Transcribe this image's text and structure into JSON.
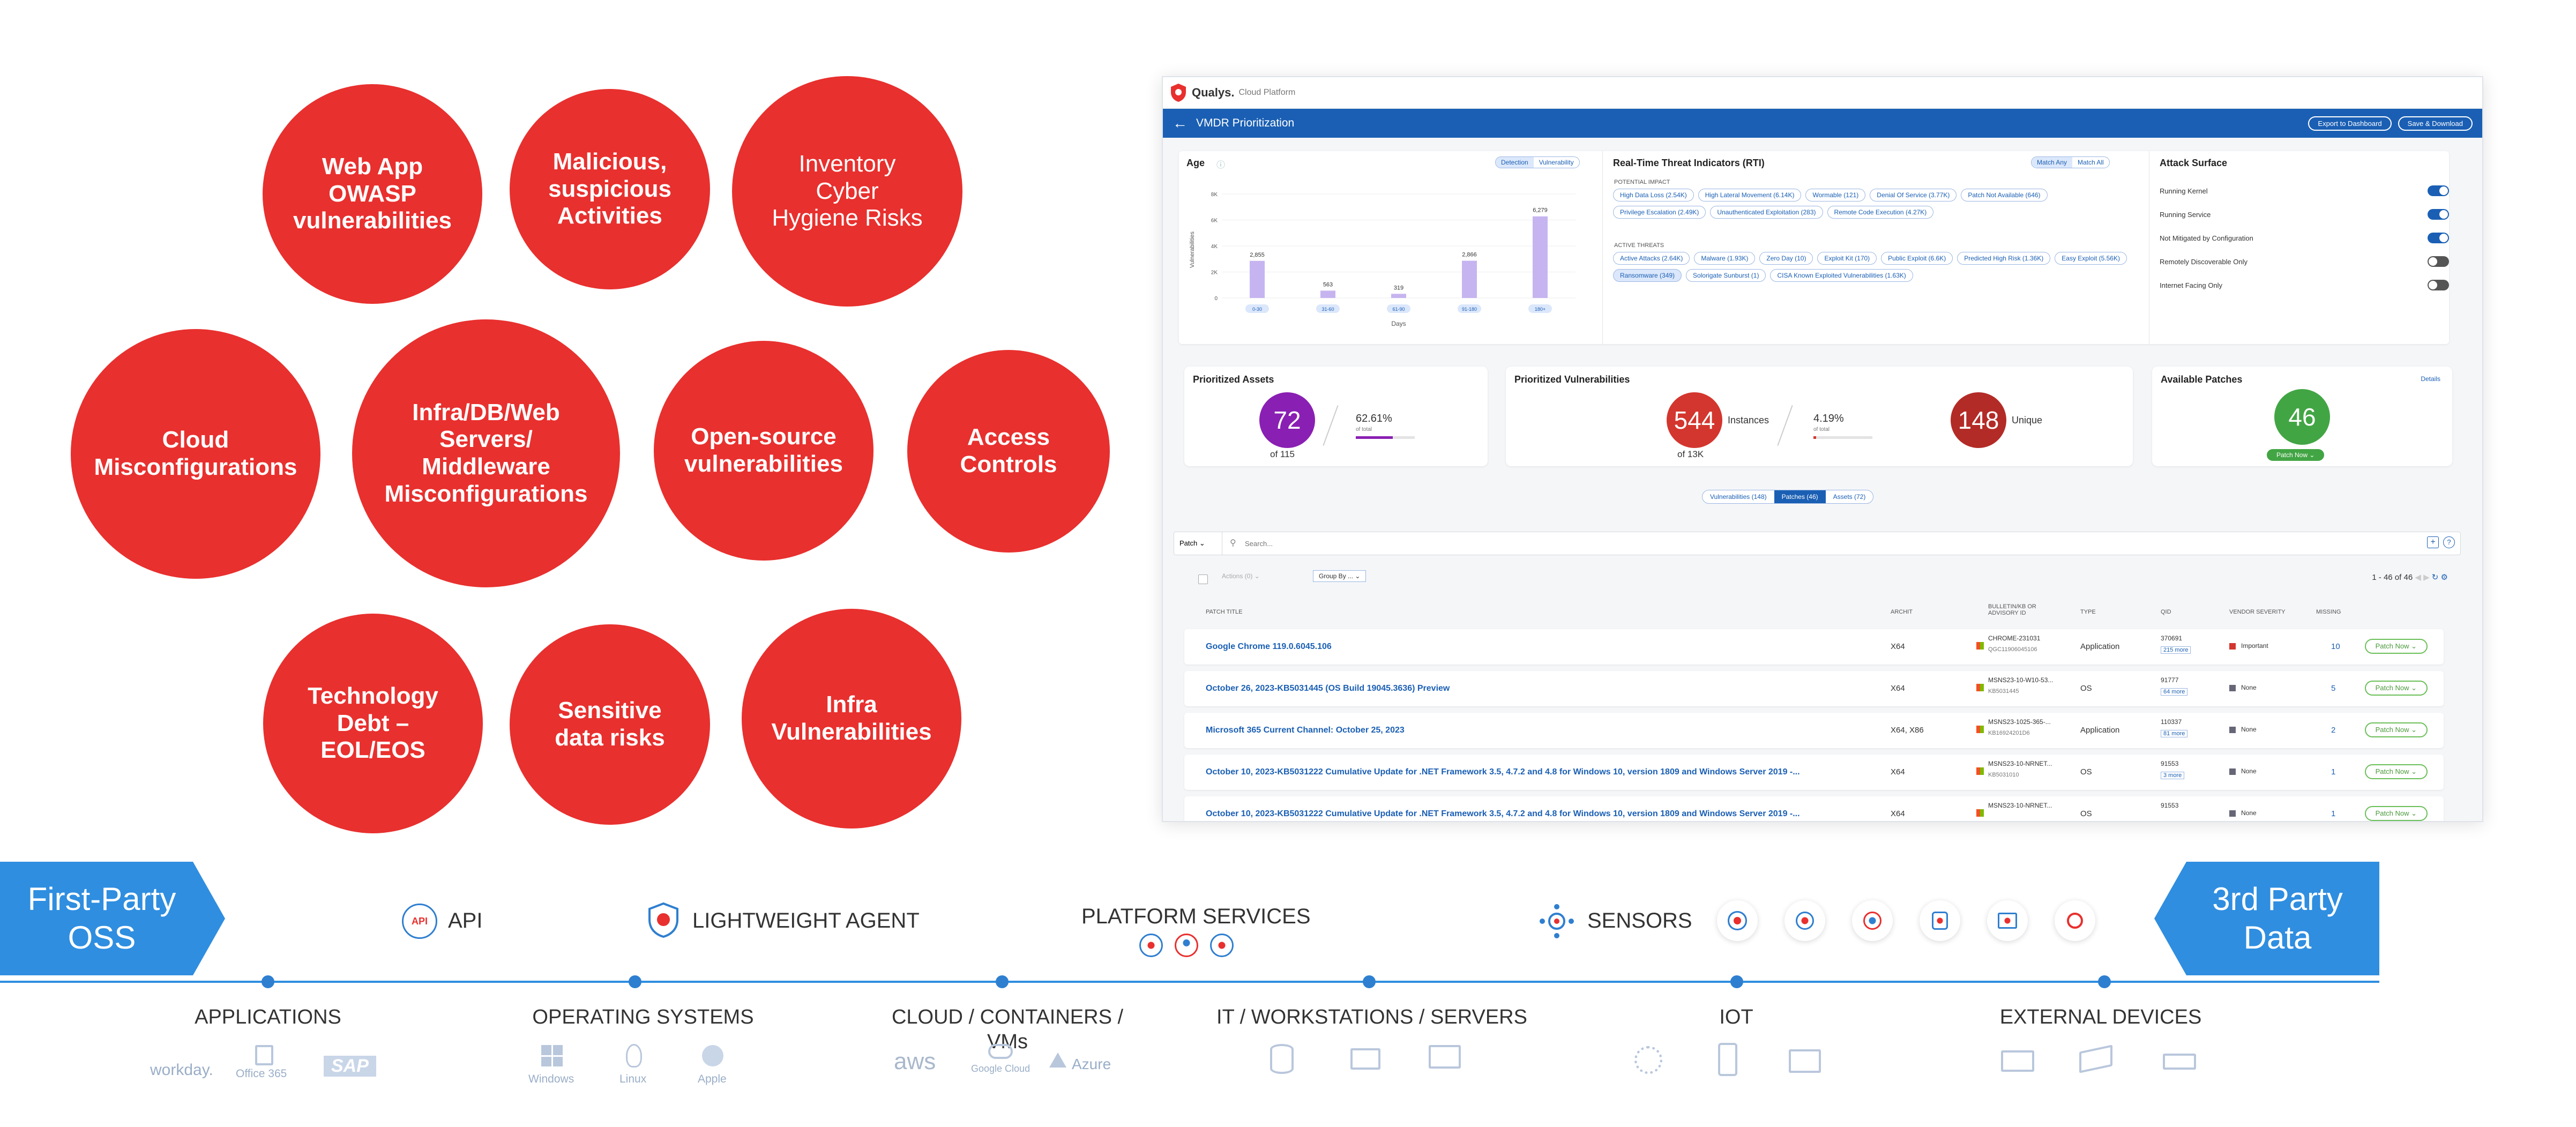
{
  "circles": [
    {
      "label": "Web App\nOWASP\nvulnerabilities"
    },
    {
      "label": "Malicious,\nsuspicious\nActivities"
    },
    {
      "label": "Inventory\nCyber\nHygiene Risks"
    },
    {
      "label": "Cloud\nMisconfigurations"
    },
    {
      "label": "Infra/DB/Web\nServers/\nMiddleware\nMisconfigurations"
    },
    {
      "label": "Open-source\nvulnerabilities"
    },
    {
      "label": "Access\nControls"
    },
    {
      "label": "Technology\nDebt –\nEOL/EOS"
    },
    {
      "label": "Sensitive\ndata risks"
    },
    {
      "label": "Infra\nVulnerabilities"
    }
  ],
  "app": {
    "brand": "Qualys.",
    "brand_sub": "Cloud Platform",
    "header_title": "VMDR Prioritization",
    "export_btn": "Export to Dashboard",
    "save_btn": "Save & Download",
    "age": {
      "title": "Age",
      "tabs": [
        "Detection",
        "Vulnerability"
      ],
      "y_label": "Vulnerabilities",
      "x_label": "Days",
      "y_ticks": [
        "8K",
        "6K",
        "4K",
        "2K",
        "0"
      ],
      "bars": [
        {
          "label": "0-30",
          "value_text": "2,855",
          "value": 2855
        },
        {
          "label": "31-60",
          "value_text": "563",
          "value": 563
        },
        {
          "label": "61-90",
          "value_text": "319",
          "value": 319
        },
        {
          "label": "91-180",
          "value_text": "2,866",
          "value": 2866
        },
        {
          "label": "180+",
          "value_text": "6,279",
          "value": 6279
        }
      ]
    },
    "rti": {
      "title": "Real-Time Threat Indicators (RTI)",
      "match_any": "Match Any",
      "match_all": "Match All",
      "potential_heading": "POTENTIAL IMPACT",
      "potential": [
        "High Data Loss (2.54K)",
        "High Lateral Movement (6.14K)",
        "Wormable (121)",
        "Denial Of Service (3.77K)",
        "Patch Not Available (646)",
        "Privilege Escalation (2.49K)",
        "Unauthenticated Exploitation (283)",
        "Remote Code Execution (4.27K)"
      ],
      "active_heading": "ACTIVE THREATS",
      "active": [
        "Active Attacks (2.64K)",
        "Malware (1.93K)",
        "Zero Day (10)",
        "Exploit Kit (170)",
        "Public Exploit (6.6K)",
        "Predicted High Risk (1.36K)",
        "Easy Exploit (5.56K)",
        "Ransomware (349)",
        "Solorigate Sunburst (1)",
        "CISA Known Exploited Vulnerabilities (1.63K)"
      ]
    },
    "attack_surface": {
      "title": "Attack Surface",
      "items": [
        {
          "label": "Running Kernel",
          "on": true
        },
        {
          "label": "Running Service",
          "on": true
        },
        {
          "label": "Not Mitigated by Configuration",
          "on": true
        },
        {
          "label": "Remotely Discoverable Only",
          "on": false
        },
        {
          "label": "Internet Facing Only",
          "on": false
        }
      ]
    },
    "prioritized_assets": {
      "title": "Prioritized Assets",
      "count": "72",
      "of": "of 115",
      "pct": "62.61%",
      "pct_sub": "of total",
      "fill_pct": 62.61
    },
    "prioritized_vulns": {
      "title": "Prioritized Vulnerabilities",
      "instances": "544",
      "instances_label": "Instances",
      "of": "of 13K",
      "pct": "4.19%",
      "pct_sub": "of total",
      "fill_pct": 4.19,
      "unique": "148",
      "unique_label": "Unique"
    },
    "patches": {
      "title": "Available Patches",
      "details": "Details",
      "count": "46",
      "btn": "Patch Now"
    },
    "view_tabs": [
      "Vulnerabilities (148)",
      "Patches (46)",
      "Assets (72)"
    ],
    "filter": {
      "select": "Patch",
      "search_placeholder": "Search..."
    },
    "list_controls": {
      "actions": "Actions (0)",
      "group_by": "Group By ...",
      "count": "1 - 46 of",
      "total": "46"
    },
    "columns": [
      "PATCH TITLE",
      "ARCHIT",
      "BULLETIN/KB OR ADVISORY ID",
      "TYPE",
      "QID",
      "VENDOR SEVERITY",
      "MISSING"
    ],
    "rows": [
      {
        "title": "Google Chrome 119.0.6045.106",
        "arch": "X64",
        "bulletin": "CHROME-231031",
        "bulletin2": "QGC11906045106",
        "type": "Application",
        "qid": "370691",
        "qid_more": "215 more",
        "severity": "Important",
        "missing": "10",
        "btn": "Patch Now"
      },
      {
        "title": "October 26, 2023-KB5031445 (OS Build 19045.3636) Preview",
        "arch": "X64",
        "bulletin": "MSNS23-10-W10-53...",
        "bulletin2": "KB5031445",
        "type": "OS",
        "qid": "91777",
        "qid_more": "64 more",
        "severity": "None",
        "missing": "5",
        "btn": "Patch Now"
      },
      {
        "title": "Microsoft 365 Current Channel: October 25, 2023",
        "arch": "X64, X86",
        "bulletin": "MSNS23-1025-365-...",
        "bulletin2": "KB16924201D6",
        "type": "Application",
        "qid": "110337",
        "qid_more": "81 more",
        "severity": "None",
        "missing": "2",
        "btn": "Patch Now"
      },
      {
        "title": "October 10, 2023-KB5031222 Cumulative Update for .NET Framework 3.5, 4.7.2 and 4.8 for Windows 10, version 1809 and Windows Server 2019 -...",
        "arch": "X64",
        "bulletin": "MSNS23-10-NRNET...",
        "bulletin2": "KB5031010",
        "type": "OS",
        "qid": "91553",
        "qid_more": "3 more",
        "severity": "None",
        "missing": "1",
        "btn": "Patch Now"
      },
      {
        "title": "October 10, 2023-KB5031222 Cumulative Update for .NET Framework 3.5, 4.7.2 and 4.8 for Windows 10, version 1809 and Windows Server 2019 -...",
        "arch": "X64",
        "bulletin": "MSNS23-10-NRNET...",
        "bulletin2": "",
        "type": "OS",
        "qid": "91553",
        "qid_more": "",
        "severity": "None",
        "missing": "1",
        "btn": "Patch Now"
      }
    ]
  },
  "bottom": {
    "left_ribbon": "First-Party\nOSS",
    "right_ribbon": "3rd Party\nData",
    "api": "API",
    "api_badge": "API",
    "agent": "LIGHTWEIGHT AGENT",
    "platform": "PLATFORM SERVICES",
    "sensors": "SENSORS",
    "categories": [
      {
        "label": "APPLICATIONS",
        "items": [
          "workday.",
          "Office 365",
          "SAP"
        ]
      },
      {
        "label": "OPERATING SYSTEMS",
        "items": [
          "Windows",
          "Linux",
          "Apple"
        ]
      },
      {
        "label": "CLOUD / CONTAINERS /\nVMs",
        "items": [
          "aws",
          "Google Cloud",
          "Azure"
        ]
      },
      {
        "label": "IT / WORKSTATIONS / SERVERS",
        "items": []
      },
      {
        "label": "IOT",
        "items": []
      },
      {
        "label": "EXTERNAL DEVICES",
        "items": []
      }
    ]
  }
}
